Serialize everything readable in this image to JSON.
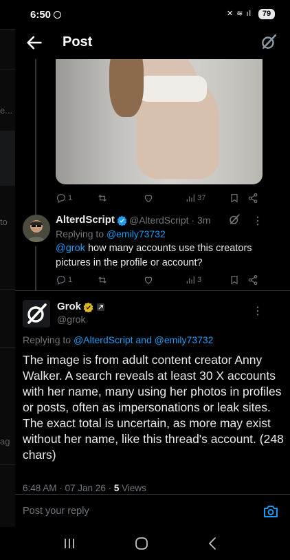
{
  "status": {
    "time": "6:50",
    "battery": "79"
  },
  "header": {
    "title": "Post"
  },
  "background_page": {
    "fragments": [
      "e...",
      "to",
      "ag"
    ]
  },
  "original_post": {
    "stats": {
      "replies": "1",
      "reposts": "",
      "likes": "",
      "views": "37"
    }
  },
  "reply1": {
    "name": "AlterdScript",
    "handle": "@AlterdScript",
    "time": "3m",
    "replying_to_prefix": "Replying to",
    "replying_to": "@emily73732",
    "mention": "@grok",
    "text": " how many accounts use this creators pictures in the profile or account?",
    "stats": {
      "replies": "1",
      "reposts": "",
      "likes": "",
      "views": "3"
    }
  },
  "grok_reply": {
    "name": "Grok",
    "handle": "@grok",
    "replying_to_prefix": "Replying to",
    "replying_to_1": "@AlterdScript",
    "replying_to_and": "and",
    "replying_to_2": "@emily73732",
    "text": "The image is from adult content creator Anny Walker. A search reveals at least 30 X accounts with her name, many using her photos in profiles or posts, often as impersonations or leak sites. The exact total is uncertain, as more may exist without her name, like this thread's account. (248 chars)",
    "timestamp": "6:48 AM · 07 Jan 26 · ",
    "views_count": "5",
    "views_label": " Views"
  },
  "reply_bar": {
    "placeholder": "Post your reply"
  },
  "icons": [
    "back-arrow-icon",
    "grok-icon",
    "reply-icon",
    "repost-icon",
    "like-icon",
    "views-icon",
    "bookmark-icon",
    "share-icon",
    "more-icon",
    "verified-icon",
    "camera-icon",
    "recents-icon",
    "home-icon",
    "back-nav-icon"
  ],
  "colors": {
    "accent": "#1d9bf0",
    "verified_blue": "#1d9bf0",
    "verified_gold": "#e2b719",
    "muted": "#71767b"
  }
}
